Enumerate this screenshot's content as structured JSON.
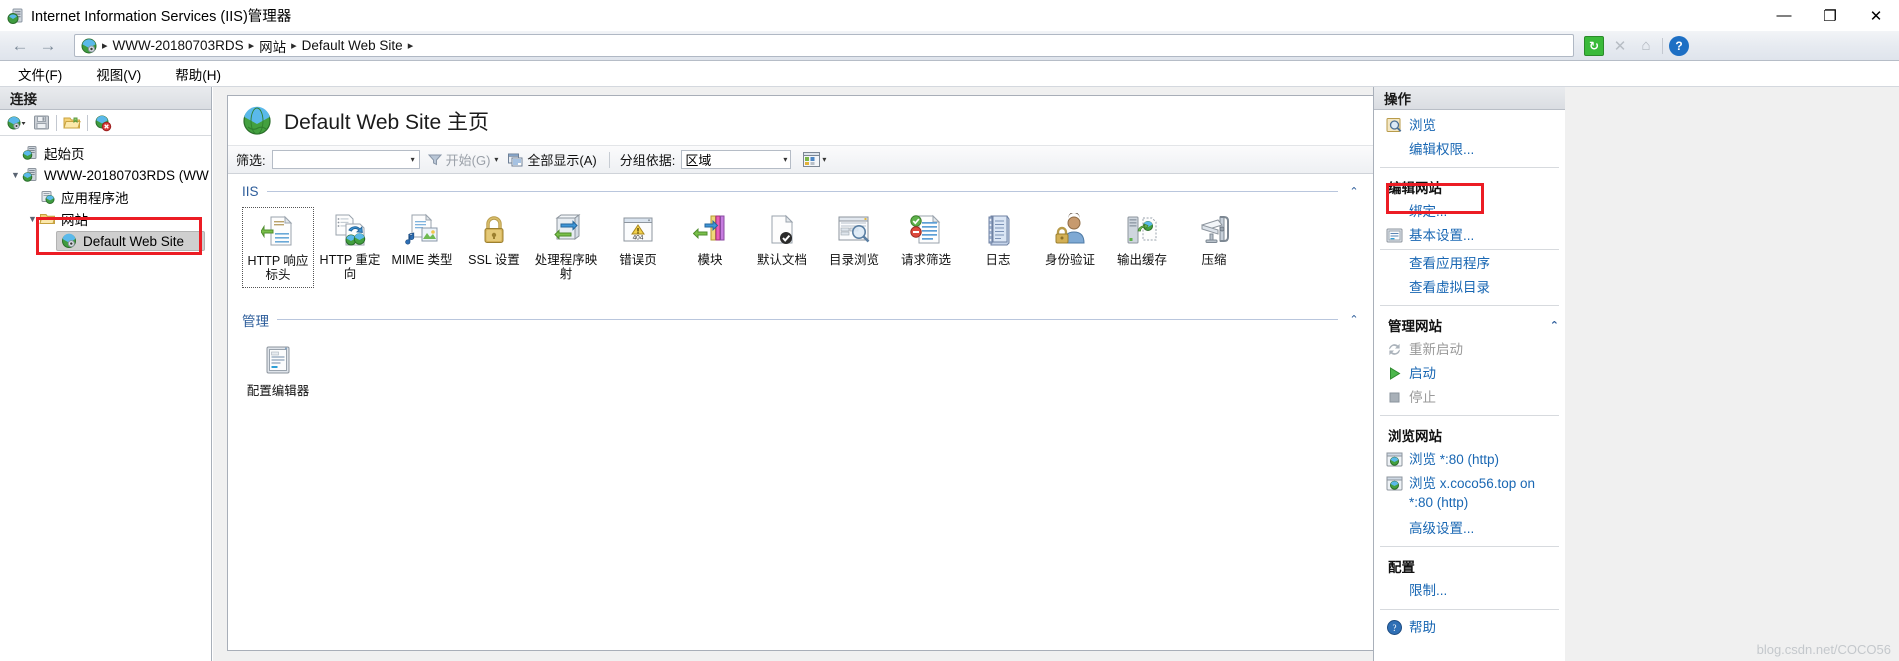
{
  "window": {
    "title": "Internet Information Services (IIS)管理器",
    "icon": "iis-manager-icon",
    "minimize": "—",
    "maximize": "❐",
    "close": "✕"
  },
  "address_bar": {
    "back_icon": "←",
    "forward_icon": "→",
    "site_icon": "globe-icon",
    "crumbs": [
      "WWW-20180703RDS",
      "网站",
      "Default Web Site"
    ],
    "separator": "▸",
    "tools": [
      {
        "name": "refresh-button",
        "glyph": "↻"
      },
      {
        "name": "stop-button",
        "glyph": "✕"
      },
      {
        "name": "home-button",
        "glyph": "⌂"
      },
      {
        "name": "help-button",
        "glyph": "?"
      }
    ]
  },
  "menubar": {
    "items": [
      {
        "name": "menu-file",
        "label": "文件(F)"
      },
      {
        "name": "menu-view",
        "label": "视图(V)"
      },
      {
        "name": "menu-help",
        "label": "帮助(H)"
      }
    ]
  },
  "connections": {
    "header": "连接",
    "toolbar": [
      {
        "name": "connect-to-server-button",
        "icon": "globe-dropdown-icon"
      },
      {
        "name": "save-connections-button",
        "icon": "save-icon"
      },
      {
        "name": "open-connection-button",
        "icon": "folder-open-icon"
      },
      {
        "name": "delete-connection-button",
        "icon": "globe-delete-icon"
      }
    ],
    "tree": [
      {
        "name": "tree-item-start-page",
        "label": "起始页",
        "icon": "start-page-icon",
        "level": 1,
        "expander": "",
        "selected": false
      },
      {
        "name": "tree-item-server",
        "label": "WWW-20180703RDS (WW",
        "icon": "server-icon",
        "level": 1,
        "expander": "v",
        "selected": false
      },
      {
        "name": "tree-item-app-pools",
        "label": "应用程序池",
        "icon": "app-pool-icon",
        "level": 2,
        "expander": "",
        "selected": false
      },
      {
        "name": "tree-item-sites",
        "label": "网站",
        "icon": "sites-folder-icon",
        "level": 2,
        "expander": "v",
        "selected": false
      },
      {
        "name": "tree-item-default-web-site",
        "label": "Default Web Site",
        "icon": "website-icon",
        "level": 3,
        "expander": "",
        "selected": true
      }
    ]
  },
  "content": {
    "page_title": "Default Web Site 主页",
    "page_icon": "globe-icon",
    "filter": {
      "label": "筛选:",
      "value": "",
      "placeholder": "",
      "dropdown_caret": "▾",
      "go_label": "开始(G)",
      "go_caret": "▾",
      "show_all_label": "全部显示(A)",
      "group_by_label": "分组依据:",
      "group_by_value": "区域",
      "view_icon": "view-mode-icon",
      "view_caret": "▾"
    },
    "sections": [
      {
        "name": "section-iis",
        "title": "IIS",
        "collapse_glyph": "⌃",
        "features": [
          {
            "name": "feature-http-response-headers",
            "label": "HTTP 响应标头",
            "icon": "http-response-headers-icon",
            "selected": true
          },
          {
            "name": "feature-http-redirect",
            "label": "HTTP 重定向",
            "icon": "http-redirect-icon",
            "selected": false
          },
          {
            "name": "feature-mime-types",
            "label": "MIME 类型",
            "icon": "mime-types-icon",
            "selected": false
          },
          {
            "name": "feature-ssl-settings",
            "label": "SSL 设置",
            "icon": "ssl-lock-icon",
            "selected": false
          },
          {
            "name": "feature-handler-mappings",
            "label": "处理程序映射",
            "icon": "handler-mappings-icon",
            "selected": false
          },
          {
            "name": "feature-error-pages",
            "label": "错误页",
            "icon": "error-pages-404-icon",
            "selected": false
          },
          {
            "name": "feature-modules",
            "label": "模块",
            "icon": "modules-icon",
            "selected": false
          },
          {
            "name": "feature-default-document",
            "label": "默认文档",
            "icon": "default-document-icon",
            "selected": false
          },
          {
            "name": "feature-directory-browsing",
            "label": "目录浏览",
            "icon": "directory-browsing-icon",
            "selected": false
          },
          {
            "name": "feature-request-filtering",
            "label": "请求筛选",
            "icon": "request-filtering-icon",
            "selected": false
          },
          {
            "name": "feature-logging",
            "label": "日志",
            "icon": "logging-book-icon",
            "selected": false
          },
          {
            "name": "feature-authentication",
            "label": "身份验证",
            "icon": "authentication-icon",
            "selected": false
          },
          {
            "name": "feature-output-caching",
            "label": "输出缓存",
            "icon": "output-caching-icon",
            "selected": false
          },
          {
            "name": "feature-compression",
            "label": "压缩",
            "icon": "compression-clamp-icon",
            "selected": false
          }
        ]
      },
      {
        "name": "section-management",
        "title": "管理",
        "collapse_glyph": "⌃",
        "features": [
          {
            "name": "feature-configuration-editor",
            "label": "配置编辑器",
            "icon": "configuration-editor-icon",
            "selected": false
          }
        ]
      }
    ]
  },
  "actions": {
    "header": "操作",
    "groups": [
      {
        "name": "actions-group-top",
        "title": null,
        "items": [
          {
            "name": "action-browse",
            "label": "浏览",
            "icon": "browse-magnifier-icon",
            "disabled": false,
            "highlighted": false
          },
          {
            "name": "action-edit-permissions",
            "label": "编辑权限...",
            "icon": null,
            "disabled": false,
            "highlighted": false
          }
        ]
      },
      {
        "name": "actions-group-edit-site",
        "title": "编辑网站",
        "items": [
          {
            "name": "action-bindings",
            "label": "绑定...",
            "icon": null,
            "disabled": false,
            "highlighted": true
          },
          {
            "name": "action-basic-settings",
            "label": "基本设置...",
            "icon": "basic-settings-icon",
            "disabled": false,
            "highlighted": false
          },
          {
            "name": "action-view-applications",
            "label": "查看应用程序",
            "icon": null,
            "disabled": false,
            "highlighted": false
          },
          {
            "name": "action-view-virtual-directories",
            "label": "查看虚拟目录",
            "icon": null,
            "disabled": false,
            "highlighted": false
          }
        ]
      },
      {
        "name": "actions-group-manage-site",
        "title": "管理网站",
        "collapse_glyph": "⌃",
        "items": [
          {
            "name": "action-restart",
            "label": "重新启动",
            "icon": "restart-icon",
            "disabled": true,
            "highlighted": false
          },
          {
            "name": "action-start",
            "label": "启动",
            "icon": "start-play-icon",
            "disabled": false,
            "highlighted": false
          },
          {
            "name": "action-stop",
            "label": "停止",
            "icon": "stop-square-icon",
            "disabled": true,
            "highlighted": false
          }
        ]
      },
      {
        "name": "actions-group-browse-website",
        "title": "浏览网站",
        "items": [
          {
            "name": "action-browse-80-http",
            "label": "浏览 *:80 (http)",
            "icon": "browse-window-icon",
            "disabled": false,
            "highlighted": false
          },
          {
            "name": "action-browse-xcoco56",
            "label": "浏览 x.coco56.top on *:80 (http)",
            "icon": "browse-window-icon",
            "disabled": false,
            "highlighted": false
          },
          {
            "name": "action-advanced-settings",
            "label": "高级设置...",
            "icon": null,
            "disabled": false,
            "highlighted": false
          }
        ]
      },
      {
        "name": "actions-group-configure",
        "title": "配置",
        "items": [
          {
            "name": "action-limits",
            "label": "限制...",
            "icon": null,
            "disabled": false,
            "highlighted": false
          }
        ]
      },
      {
        "name": "actions-group-help",
        "title": null,
        "items": [
          {
            "name": "action-help",
            "label": "帮助",
            "icon": "help-circle-icon",
            "disabled": false,
            "highlighted": false
          }
        ]
      }
    ]
  },
  "watermark": "blog.csdn.net/COCO56",
  "colors": {
    "highlight_red": "#ec1c24",
    "link_blue": "#1967b3",
    "section_blue": "#2c5c9a"
  }
}
